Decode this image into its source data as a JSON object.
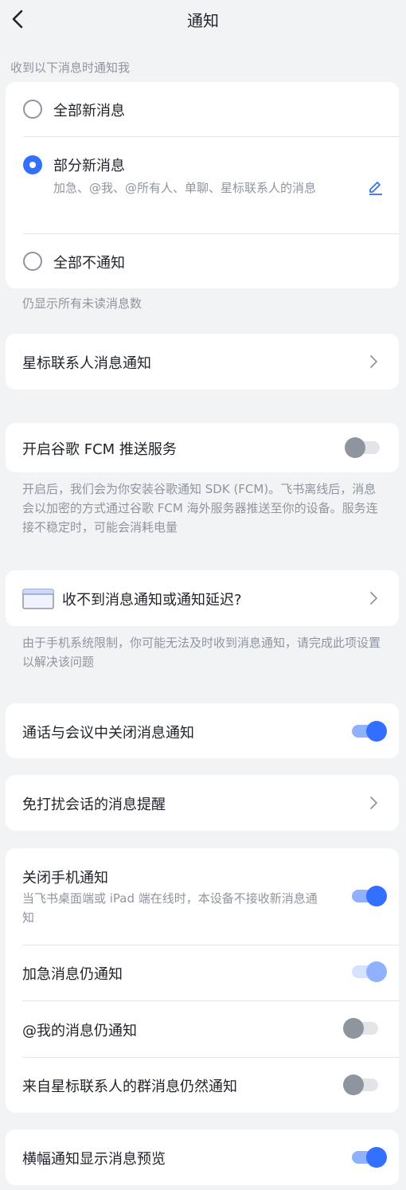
{
  "header": {
    "title": "通知",
    "back_icon": "chevron-left-icon"
  },
  "notify_section": {
    "label": "收到以下消息时通知我",
    "options": [
      {
        "label": "全部新消息",
        "selected": false
      },
      {
        "label": "部分新消息",
        "selected": true,
        "detail": "加急、@我、@所有人、单聊、星标联系人的消息",
        "edit_icon": "pencil-icon"
      },
      {
        "label": "全部不通知",
        "selected": false
      }
    ],
    "footnote": "仍显示所有未读消息数"
  },
  "starred_contacts": {
    "label": "星标联系人消息通知"
  },
  "fcm": {
    "label": "开启谷歌 FCM 推送服务",
    "enabled": false,
    "description": "开启后，我们会为你安装谷歌通知 SDK (FCM)。飞书离线后，消息会以加密的方式通过谷歌 FCM 海外服务器推送至你的设备。服务连接不稳定时，可能会消耗电量"
  },
  "delay": {
    "label": "收不到消息通知或通知延迟?",
    "icon": "device-window-icon",
    "description": "由于手机系统限制，你可能无法及时收到消息通知，请完成此项设置以解决该问题"
  },
  "call_meeting": {
    "label": "通话与会议中关闭消息通知",
    "enabled": true
  },
  "dnd_reminder": {
    "label": "免打扰会话的消息提醒"
  },
  "phone_group": {
    "close_phone": {
      "label": "关闭手机通知",
      "detail": "当飞书桌面端或 iPad 端在线时，本设备不接收新消息通知",
      "enabled": true
    },
    "urgent": {
      "label": "加急消息仍通知",
      "enabled": true
    },
    "mention": {
      "label": "@我的消息仍通知",
      "enabled": false
    },
    "starred_group": {
      "label": "来自星标联系人的群消息仍然通知",
      "enabled": false
    }
  },
  "banner_preview": {
    "label": "横幅通知显示消息预览",
    "enabled": true
  },
  "colors": {
    "accent": "#3370ff",
    "background": "#f2f3f5",
    "secondary_text": "#8f959e"
  }
}
